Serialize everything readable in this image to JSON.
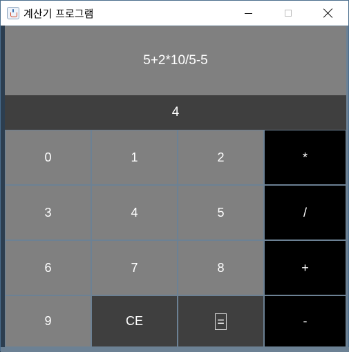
{
  "window": {
    "title": "계산기 프로그램"
  },
  "display": {
    "expression": "5+2*10/5-5",
    "result": "4"
  },
  "keypad": {
    "keys": [
      {
        "label": "0",
        "kind": "num"
      },
      {
        "label": "1",
        "kind": "num"
      },
      {
        "label": "2",
        "kind": "num"
      },
      {
        "label": "*",
        "kind": "op"
      },
      {
        "label": "3",
        "kind": "num"
      },
      {
        "label": "4",
        "kind": "num"
      },
      {
        "label": "5",
        "kind": "num"
      },
      {
        "label": "/",
        "kind": "op"
      },
      {
        "label": "6",
        "kind": "num"
      },
      {
        "label": "7",
        "kind": "num"
      },
      {
        "label": "8",
        "kind": "num"
      },
      {
        "label": "+",
        "kind": "op"
      },
      {
        "label": "9",
        "kind": "num"
      },
      {
        "label": "CE",
        "kind": "dark"
      },
      {
        "label": "=",
        "kind": "dark"
      },
      {
        "label": "-",
        "kind": "op"
      }
    ]
  },
  "colors": {
    "number_key": "#808080",
    "operator_key": "#000000",
    "dark_key": "#3f3f3f",
    "text": "#ffffff"
  }
}
